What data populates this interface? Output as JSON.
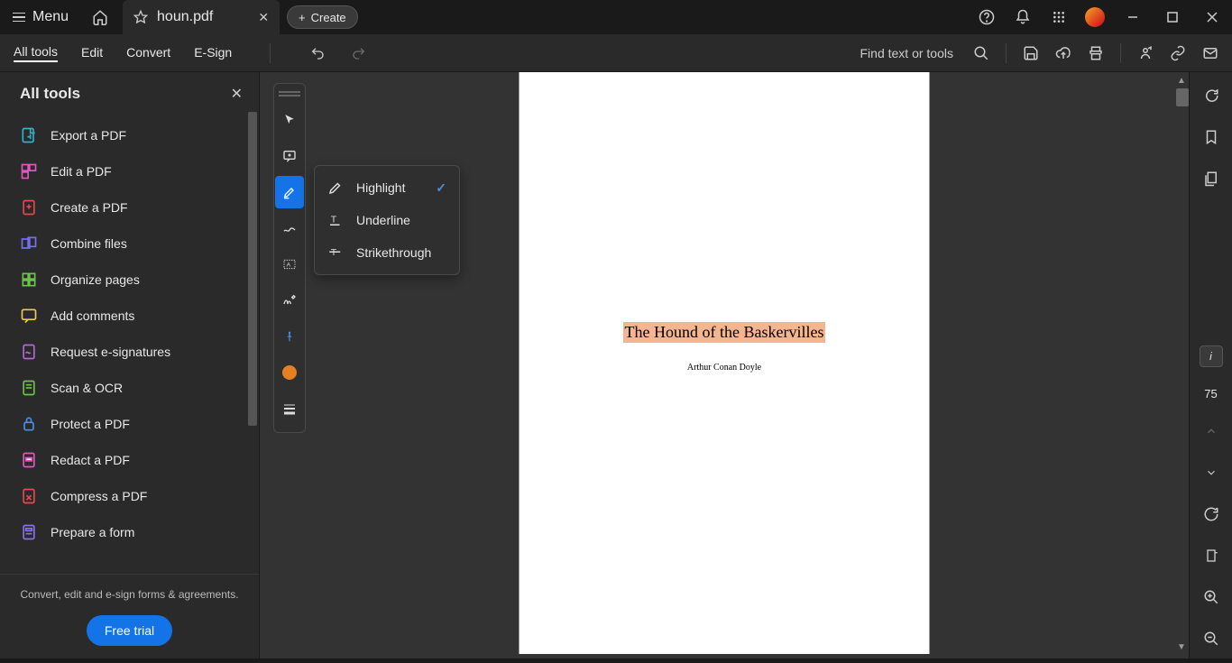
{
  "titlebar": {
    "menu_label": "Menu",
    "tab_filename": "houn.pdf",
    "create_label": "Create"
  },
  "toolbar": {
    "tabs": [
      "All tools",
      "Edit",
      "Convert",
      "E-Sign"
    ],
    "search_label": "Find text or tools"
  },
  "sidebar": {
    "title": "All tools",
    "items": [
      {
        "label": "Export a PDF",
        "color": "#36b0c9"
      },
      {
        "label": "Edit a PDF",
        "color": "#e256c1"
      },
      {
        "label": "Create a PDF",
        "color": "#e34850"
      },
      {
        "label": "Combine files",
        "color": "#7a6ff0"
      },
      {
        "label": "Organize pages",
        "color": "#6cc24a"
      },
      {
        "label": "Add comments",
        "color": "#f2c94c"
      },
      {
        "label": "Request e-signatures",
        "color": "#b565d8"
      },
      {
        "label": "Scan & OCR",
        "color": "#6cc24a"
      },
      {
        "label": "Protect a PDF",
        "color": "#4a90e2"
      },
      {
        "label": "Redact a PDF",
        "color": "#e256c1"
      },
      {
        "label": "Compress a PDF",
        "color": "#e34850"
      },
      {
        "label": "Prepare a form",
        "color": "#8a6ff0"
      }
    ],
    "footer_text": "Convert, edit and e-sign forms & agreements.",
    "cta": "Free trial"
  },
  "annotations_popup": {
    "items": [
      {
        "label": "Highlight",
        "checked": true
      },
      {
        "label": "Underline",
        "checked": false
      },
      {
        "label": "Strikethrough",
        "checked": false
      }
    ]
  },
  "document": {
    "title": "The Hound of the Baskervilles",
    "author": "Arthur Conan Doyle"
  },
  "right_rail": {
    "current_page_label": "i",
    "total_pages": "75"
  }
}
